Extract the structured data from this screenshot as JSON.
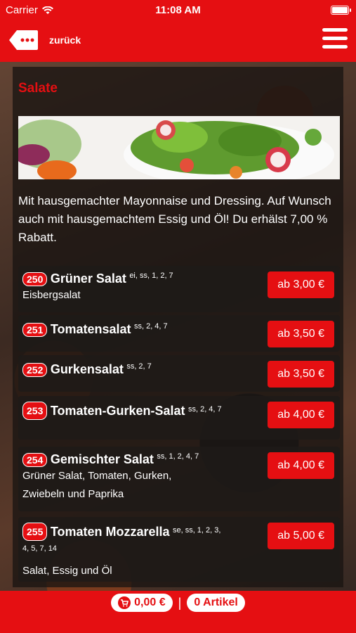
{
  "status": {
    "carrier": "Carrier",
    "time": "11:08 AM"
  },
  "nav": {
    "back_label": "zurück"
  },
  "section": {
    "title": "Salate",
    "description": "Mit hausgemachter Mayonnaise und Dressing. Auf Wunsch auch mit hausgemachtem Essig und Öl! Du erhälst 7,00 % Rabatt."
  },
  "items": [
    {
      "num": "250",
      "name": "Grüner Salat",
      "allergens": "ei, ss, 1, 2, 7",
      "desc": "Eisbergsalat",
      "price": "ab 3,00 €"
    },
    {
      "num": "251",
      "name": "Tomatensalat",
      "allergens": "ss, 2, 4, 7",
      "desc": "",
      "price": "ab 3,50 €"
    },
    {
      "num": "252",
      "name": "Gurkensalat",
      "allergens": "ss, 2, 7",
      "desc": "",
      "price": "ab 3,50 €"
    },
    {
      "num": "253",
      "name": "Tomaten-Gurken-Salat",
      "allergens": "ss, 2, 4, 7",
      "desc": "",
      "price": "ab 4,00 €"
    },
    {
      "num": "254",
      "name": "Gemischter Salat",
      "allergens": "ss, 1, 2, 4, 7",
      "desc": "Grüner Salat, Tomaten, Gurken, Zwiebeln und Paprika",
      "price": "ab 4,00 €"
    },
    {
      "num": "255",
      "name": "Tomaten Mozzarella",
      "allergens": "se, ss, 1, 2, 3, 4, 5, 7, 14",
      "desc": "Salat, Essig und Öl",
      "price": "ab 5,00 €"
    }
  ],
  "cart": {
    "total": "0,00 €",
    "separator": "|",
    "count": "0 Artikel"
  }
}
